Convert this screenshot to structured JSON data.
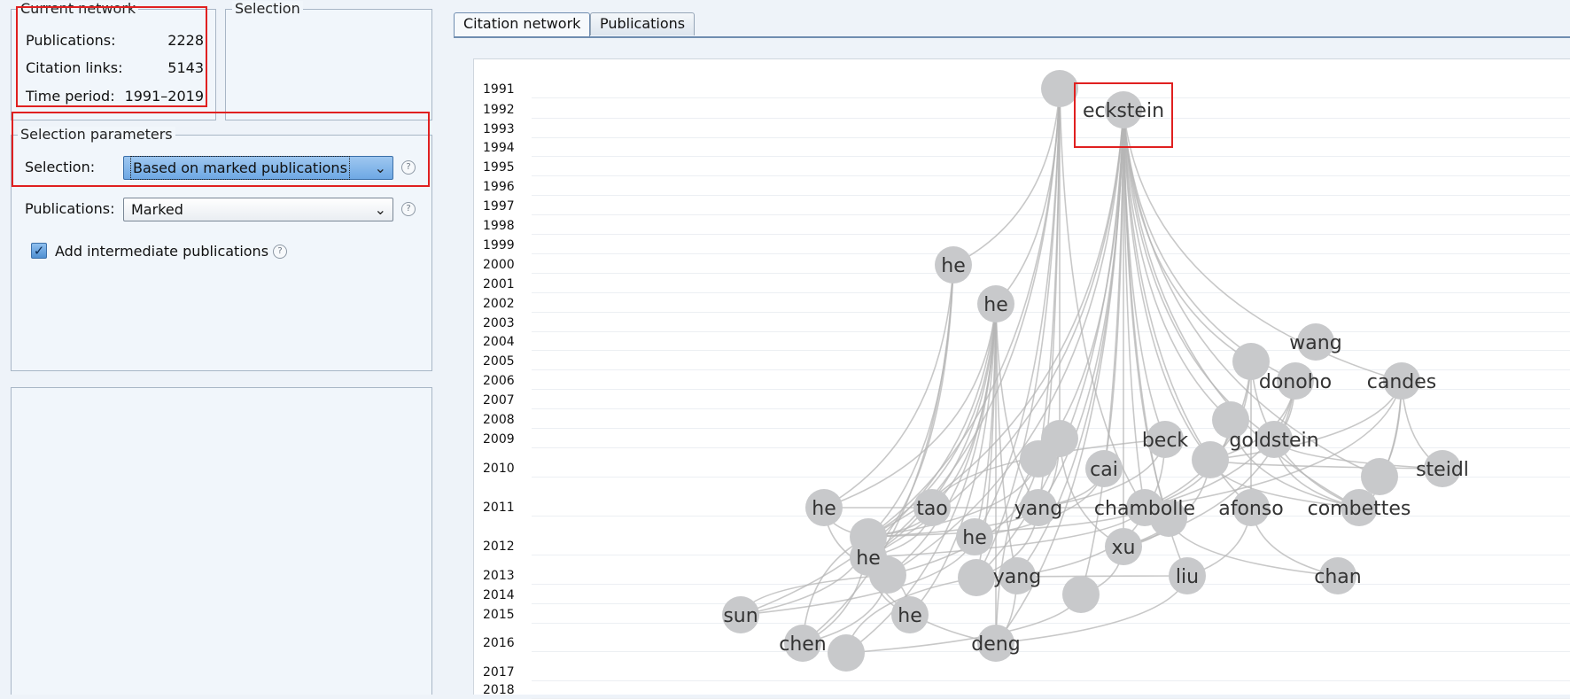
{
  "current_network": {
    "legend": "Current network",
    "rows": [
      {
        "label": "Publications:",
        "value": "2228"
      },
      {
        "label": "Citation links:",
        "value": "5143"
      },
      {
        "label": "Time period:",
        "value": "1991–2019"
      }
    ]
  },
  "selection": {
    "legend": "Selection"
  },
  "selection_parameters": {
    "legend": "Selection parameters",
    "selection_label": "Selection:",
    "selection_value": "Based on marked publications",
    "publications_label": "Publications:",
    "publications_value": "Marked",
    "intermediate_label": "Add intermediate publications",
    "intermediate_checked": true
  },
  "tabs": [
    {
      "label": "Citation network",
      "active": true
    },
    {
      "label": "Publications",
      "active": false
    }
  ],
  "years": [
    "1991",
    "1992",
    "1993",
    "1994",
    "1995",
    "1996",
    "1997",
    "1998",
    "1999",
    "2000",
    "2001",
    "2002",
    "2003",
    "2004",
    "2005",
    "2006",
    "2007",
    "2008",
    "2009",
    "2010",
    "2011",
    "2012",
    "2013",
    "2014",
    "2015",
    "2016",
    "2017",
    "2018"
  ],
  "network": {
    "node_color": "#c8c9cb",
    "edge_color": "#b5b5b5",
    "highlight_color": "#e02020",
    "highlighted_label": "eckstein",
    "nodes": [
      {
        "label": "",
        "year": "1991"
      },
      {
        "label": "eckstein",
        "year": "1992"
      },
      {
        "label": "he",
        "year": "2000"
      },
      {
        "label": "he",
        "year": "2002"
      },
      {
        "label": "wang",
        "year": "2004"
      },
      {
        "label": "",
        "year": "2005"
      },
      {
        "label": "donoho",
        "year": "2006"
      },
      {
        "label": "candes",
        "year": "2006"
      },
      {
        "label": "",
        "year": "2008"
      },
      {
        "label": "",
        "year": "2009"
      },
      {
        "label": "beck",
        "year": "2009"
      },
      {
        "label": "goldstein",
        "year": "2009"
      },
      {
        "label": "cai",
        "year": "2010"
      },
      {
        "label": "",
        "year": "2010"
      },
      {
        "label": "",
        "year": "2010"
      },
      {
        "label": "steidl",
        "year": "2010"
      },
      {
        "label": "",
        "year": "2010"
      },
      {
        "label": "he",
        "year": "2011"
      },
      {
        "label": "tao",
        "year": "2011"
      },
      {
        "label": "yang",
        "year": "2011"
      },
      {
        "label": "chambolle",
        "year": "2011"
      },
      {
        "label": "afonso",
        "year": "2011"
      },
      {
        "label": "combettes",
        "year": "2011"
      },
      {
        "label": "",
        "year": "2011"
      },
      {
        "label": "",
        "year": "2012"
      },
      {
        "label": "he",
        "year": "2012"
      },
      {
        "label": "xu",
        "year": "2012"
      },
      {
        "label": "he",
        "year": "2012"
      },
      {
        "label": "",
        "year": "2012"
      },
      {
        "label": "",
        "year": "2013"
      },
      {
        "label": "yang",
        "year": "2013"
      },
      {
        "label": "liu",
        "year": "2013"
      },
      {
        "label": "chan",
        "year": "2013"
      },
      {
        "label": "",
        "year": "2014"
      },
      {
        "label": "sun",
        "year": "2015"
      },
      {
        "label": "he",
        "year": "2015"
      },
      {
        "label": "chen",
        "year": "2016"
      },
      {
        "label": "deng",
        "year": "2016"
      },
      {
        "label": "",
        "year": "2017"
      }
    ]
  }
}
